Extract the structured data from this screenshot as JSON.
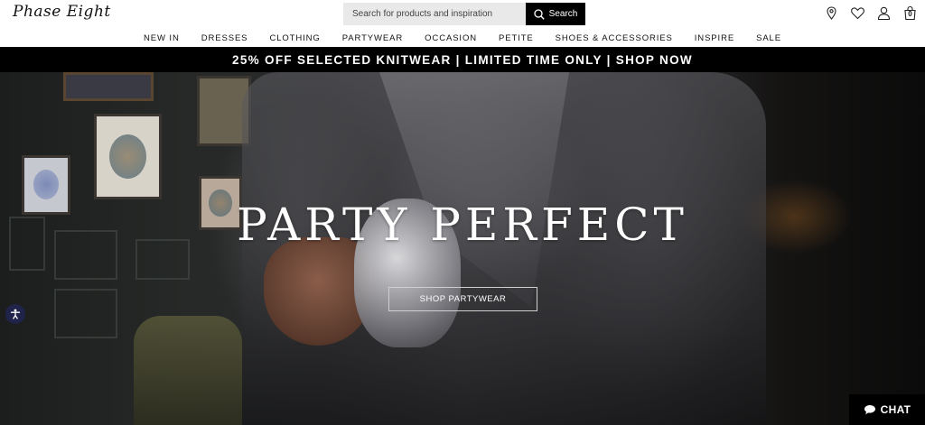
{
  "header": {
    "logo_text": "Phase Eight",
    "search": {
      "placeholder": "Search for products and inspiration",
      "button_label": "Search"
    },
    "icons": [
      "location-pin-icon",
      "heart-icon",
      "account-icon",
      "bag-icon"
    ],
    "bag_count": "0"
  },
  "nav": {
    "items": [
      "NEW IN",
      "DRESSES",
      "CLOTHING",
      "PARTYWEAR",
      "OCCASION",
      "PETITE",
      "SHOES & ACCESSORIES",
      "INSPIRE",
      "SALE"
    ]
  },
  "promo": {
    "text": "25% OFF SELECTED KNITWEAR | LIMITED TIME ONLY | SHOP NOW"
  },
  "hero": {
    "title": "PARTY PERFECT",
    "cta_label": "SHOP PARTYWEAR"
  },
  "chat": {
    "label": "CHAT",
    "icon": "speech-bubble-icon"
  },
  "accessibility": {
    "icon": "accessibility-icon"
  },
  "colors": {
    "promo_bg": "#000000",
    "search_bg": "#e9e9e9",
    "accessibility_bg": "#20234a"
  }
}
